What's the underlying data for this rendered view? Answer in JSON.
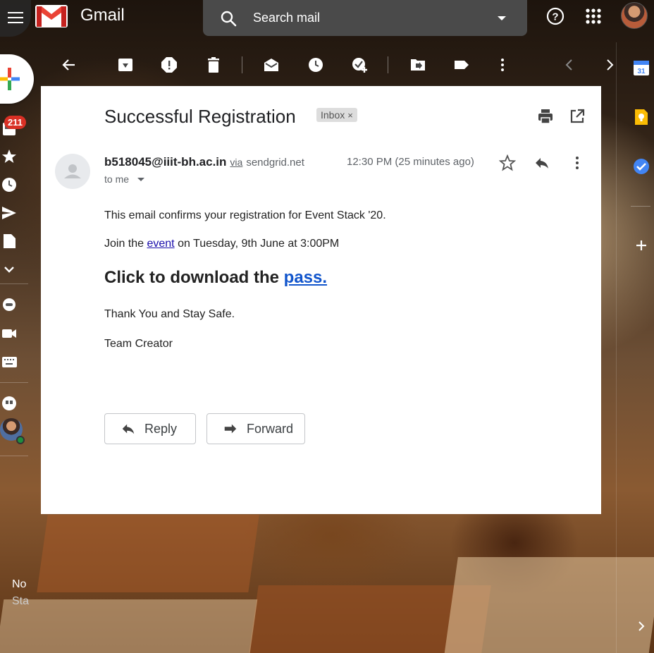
{
  "app": {
    "name": "Gmail",
    "brand_colors": {
      "red": "#EA4335",
      "blue": "#4285F4",
      "yellow": "#FBBC04",
      "green": "#34A853"
    }
  },
  "header": {
    "search_placeholder": "Search mail",
    "icons": [
      "main-menu-icon",
      "help-icon",
      "apps-grid-icon",
      "account-avatar"
    ]
  },
  "left_rail": {
    "compose_icon": "plus-icon",
    "inbox_count": "211",
    "items": [
      "inbox-icon",
      "star-icon",
      "clock-icon",
      "send-icon",
      "draft-icon",
      "more-icon",
      "chat-icon",
      "video-icon",
      "keyboard-icon",
      "hangouts-icon"
    ],
    "footer_text_1": "No",
    "footer_text_2": "Sta"
  },
  "toolbar": {
    "icons": [
      "back-arrow-icon",
      "archive-icon",
      "report-spam-icon",
      "delete-icon",
      "mark-unread-icon",
      "snooze-icon",
      "add-task-icon",
      "move-to-icon",
      "label-icon",
      "more-vert-icon",
      "prev-icon",
      "next-icon"
    ]
  },
  "right_rail": {
    "icons": [
      "calendar-icon",
      "keep-icon",
      "tasks-icon",
      "add-icon",
      "expand-icon"
    ],
    "calendar_day": "31"
  },
  "email": {
    "subject": "Successful Registration",
    "label": "Inbox",
    "sender_email": "b518045@iiit-bh.ac.in",
    "via": "via",
    "via_domain": "sendgrid.net",
    "time": "12:30 PM (25 minutes ago)",
    "to": "to me",
    "line1": "This email confirms your registration for Event Stack '20.",
    "line2_pre": "Join the ",
    "line2_link": "event",
    "line2_post": " on Tuesday, 9th June at 3:00PM",
    "headline_pre": "Click to download the ",
    "headline_link": "pass.",
    "line3": "Thank You and Stay Safe.",
    "signature": "Team Creator",
    "reply_label": "Reply",
    "forward_label": "Forward"
  }
}
